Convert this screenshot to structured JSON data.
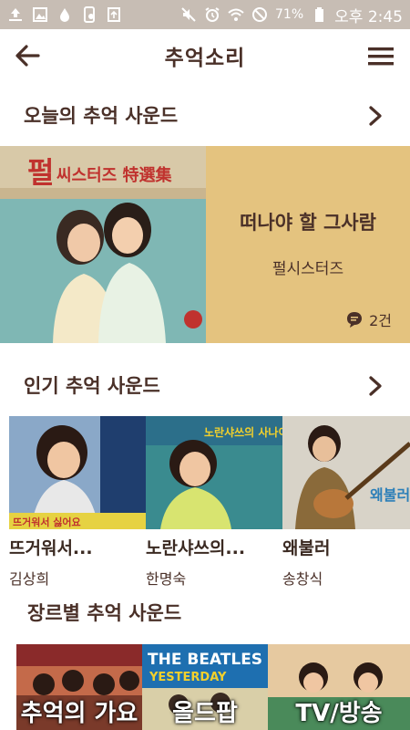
{
  "status_bar": {
    "battery_percent": "71%",
    "time": "오후 2:45",
    "icons": [
      "upload-icon",
      "image-icon",
      "drop-icon",
      "phone-sync-icon",
      "recycle-icon",
      "mute-icon",
      "alarm-icon",
      "wifi-icon",
      "blocked-icon",
      "battery-icon"
    ]
  },
  "app_bar": {
    "title": "추억소리",
    "back_icon": "arrow-left-icon",
    "menu_icon": "hamburger-menu-icon"
  },
  "sections": {
    "today": {
      "header": "오늘의 추억 사운드",
      "song_title": "떠나야 할 그사람",
      "artist": "펄시스터즈",
      "comment_count": "2건",
      "cover_text_1": "펄",
      "cover_text_2": "씨스터즈 特選集"
    },
    "popular": {
      "header": "인기 추억 사운드",
      "items": [
        {
          "title": "뜨거워서...",
          "artist": "김상희",
          "cover_caption": "뜨거워서 싫어요"
        },
        {
          "title": "노란샤쓰의...",
          "artist": "한명숙",
          "cover_caption": "노란샤쓰의 사나이"
        },
        {
          "title": "왜불러",
          "artist": "송창식",
          "cover_caption": "왜불러"
        }
      ]
    },
    "genre": {
      "header": "장르별 추억 사운드",
      "items": [
        {
          "label": "추억의 가요"
        },
        {
          "label": "올드팝",
          "cover_caption": "THE BEATLES",
          "cover_sub": "YESTERDAY"
        },
        {
          "label": "TV/방송"
        }
      ]
    }
  },
  "colors": {
    "accent_brown": "#4a3028",
    "banner_gold": "#e4c37f",
    "status_bar": "#c7bdb4"
  }
}
